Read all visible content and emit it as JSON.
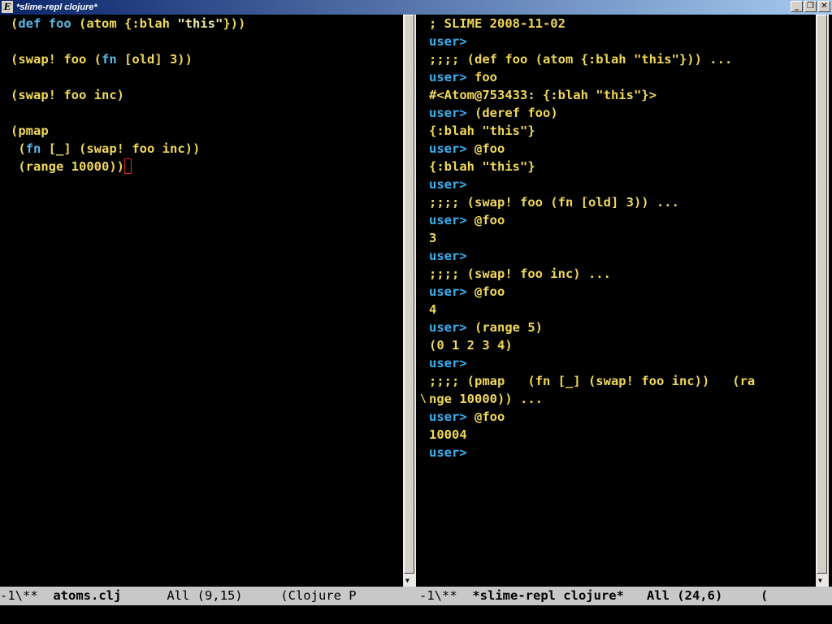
{
  "window": {
    "title": "*slime-repl clojure*",
    "buttons": {
      "minimize": "_",
      "restore": "❐",
      "close": "✕"
    }
  },
  "left_pane": {
    "lines": [
      [
        {
          "t": "(",
          "c": "n"
        },
        {
          "t": "def",
          "c": "kw"
        },
        {
          "t": " ",
          "c": "n"
        },
        {
          "t": "foo",
          "c": "kw"
        },
        {
          "t": " (atom {:blah ",
          "c": "n"
        },
        {
          "t": "\"this\"",
          "c": "str"
        },
        {
          "t": "}))",
          "c": "n"
        }
      ],
      [],
      [
        {
          "t": "(swap! foo (",
          "c": "n"
        },
        {
          "t": "fn",
          "c": "kw"
        },
        {
          "t": " [old] 3))",
          "c": "n"
        }
      ],
      [],
      [
        {
          "t": "(swap! foo inc)",
          "c": "n"
        }
      ],
      [],
      [
        {
          "t": "(pmap",
          "c": "n"
        }
      ],
      [
        {
          "t": " (",
          "c": "n"
        },
        {
          "t": "fn",
          "c": "kw"
        },
        {
          "t": " [_] (swap! foo inc))",
          "c": "n"
        }
      ],
      [
        {
          "t": " (range 10000))",
          "c": "n"
        },
        {
          "t": "",
          "c": "cursor"
        }
      ]
    ]
  },
  "right_pane": {
    "lines": [
      [
        {
          "t": "; SLIME 2008-11-02",
          "c": "n"
        }
      ],
      [
        {
          "t": "user>",
          "c": "prompt"
        }
      ],
      [
        {
          "t": ";;;; (def foo (atom {:blah \"this\"})) ...",
          "c": "n"
        }
      ],
      [
        {
          "t": "user>",
          "c": "prompt"
        },
        {
          "t": " foo",
          "c": "n"
        }
      ],
      [
        {
          "t": "#<Atom@753433: {:blah \"this\"}>",
          "c": "n"
        }
      ],
      [
        {
          "t": "user>",
          "c": "prompt"
        },
        {
          "t": " (deref foo)",
          "c": "n"
        }
      ],
      [
        {
          "t": "{:blah \"this\"}",
          "c": "n"
        }
      ],
      [
        {
          "t": "user>",
          "c": "prompt"
        },
        {
          "t": " @foo",
          "c": "n"
        }
      ],
      [
        {
          "t": "{:blah \"this\"}",
          "c": "n"
        }
      ],
      [
        {
          "t": "user>",
          "c": "prompt"
        }
      ],
      [
        {
          "t": ";;;; (swap! foo (fn [old] 3)) ...",
          "c": "n"
        }
      ],
      [
        {
          "t": "user>",
          "c": "prompt"
        },
        {
          "t": " @foo",
          "c": "n"
        }
      ],
      [
        {
          "t": "3",
          "c": "n"
        }
      ],
      [
        {
          "t": "user>",
          "c": "prompt"
        }
      ],
      [
        {
          "t": ";;;; (swap! foo inc) ...",
          "c": "n"
        }
      ],
      [
        {
          "t": "user>",
          "c": "prompt"
        },
        {
          "t": " @foo",
          "c": "n"
        }
      ],
      [
        {
          "t": "4",
          "c": "n"
        }
      ],
      [
        {
          "t": "user>",
          "c": "prompt"
        },
        {
          "t": " (range 5)",
          "c": "n"
        }
      ],
      [
        {
          "t": "(0 1 2 3 4)",
          "c": "n"
        }
      ],
      [
        {
          "t": "user>",
          "c": "prompt"
        }
      ],
      [
        {
          "t": ";;;; (pmap   (fn [_] (swap! foo inc))   (ra",
          "c": "n"
        }
      ],
      [
        {
          "t": "nge 10000)) ...",
          "c": "n"
        }
      ],
      [
        {
          "t": "user>",
          "c": "prompt"
        },
        {
          "t": " @foo",
          "c": "n"
        }
      ],
      [
        {
          "t": "10004",
          "c": "n"
        }
      ],
      [
        {
          "t": "user>",
          "c": "prompt"
        }
      ]
    ],
    "wrap_marker": "\\"
  },
  "modeline_left": {
    "prefix": "-1\\**  ",
    "buffer": "atoms.clj",
    "rest": "      All (9,15)     (Clojure P"
  },
  "modeline_right": {
    "prefix": "-1\\**  ",
    "buffer": "*slime-repl clojure*",
    "rest": "   All (24,6)     ("
  },
  "colors": {
    "code": "#f0d85a",
    "keyword": "#59b8e8",
    "string": "#f0e8a8",
    "prompt": "#3ab0f0",
    "cursor": "#e02020",
    "background": "#000000",
    "modeline": "#c8c8c8"
  }
}
